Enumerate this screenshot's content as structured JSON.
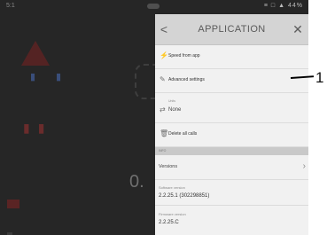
{
  "status_bar": {
    "left_text": "5:1",
    "right_text": "≡ □ ▲ 44%"
  },
  "panel": {
    "title": "APPLICATION",
    "back_glyph": "<",
    "close_glyph": "✕",
    "rows": {
      "speed": {
        "label": "Speed from app"
      },
      "advanced": {
        "label": "Advanced settings"
      },
      "units": {
        "sublabel": "Units",
        "value": "None"
      },
      "delete": {
        "label": "Delete all calls"
      }
    },
    "section": {
      "label": "INFO"
    },
    "version": {
      "label": "Versions"
    },
    "software": {
      "label": "Software version",
      "value": "2.2.25.1 (302298851)"
    },
    "firmware": {
      "label": "Firmware version",
      "value": "2.2.25.C"
    }
  },
  "background_app": {
    "big_text": "0."
  },
  "callout": {
    "number": "1"
  },
  "colors": {
    "device_bg": "#262626",
    "panel_bg": "#f1f1f1",
    "header_bg": "#d4d4d4"
  }
}
